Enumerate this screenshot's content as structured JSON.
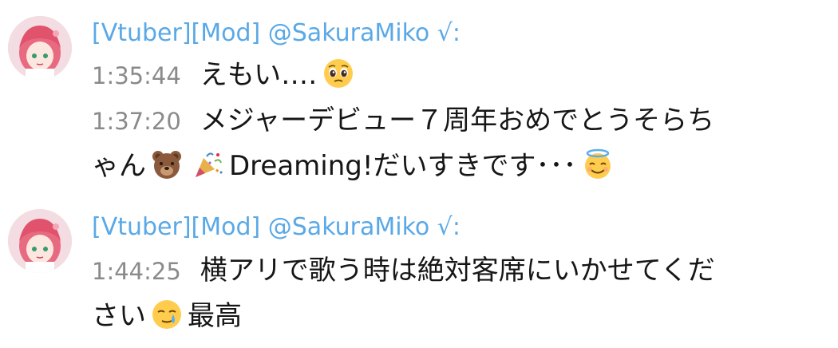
{
  "messages": [
    {
      "author": "[Vtuber][Mod] @SakuraMiko √:",
      "lines": [
        {
          "time": "1:35:44",
          "text_before": "えもい‥‥",
          "emoji": "pleading-face-icon"
        },
        {
          "time": "1:37:20",
          "text_line1": "メジャーデビュー７周年おめでとうそらち",
          "text_line2_a": "ゃん",
          "text_line2_b": "Dreaming!だいすきです･･･",
          "emoji_1": "bear-face-icon",
          "emoji_2": "party-popper-icon",
          "emoji_3": "smiling-face-with-halo-icon"
        }
      ]
    },
    {
      "author": "[Vtuber][Mod] @SakuraMiko √:",
      "lines": [
        {
          "time": "1:44:25",
          "text_line1": "横アリで歌う時は絶対客席にいかせてくだ",
          "text_line2_a": "さい",
          "text_line2_b": "最高",
          "emoji": "face-holding-back-tears-icon"
        }
      ]
    }
  ],
  "colors": {
    "author": "#5aa9e6",
    "timestamp": "#8a8a8a",
    "text": "#161616"
  }
}
